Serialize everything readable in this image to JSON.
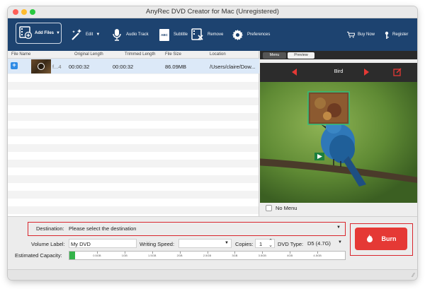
{
  "window": {
    "title": "AnyRec DVD Creator for Mac (Unregistered)"
  },
  "toolbar": {
    "add_files": "Add Files",
    "edit": "Edit",
    "audio_track": "Audio Track",
    "subtitle": "Subtitle",
    "subtitle_icon_text": "ABC",
    "remove": "Remove",
    "preferences": "Preferences",
    "buy_now": "Buy Now",
    "register": "Register"
  },
  "file_table": {
    "headers": {
      "file_name": "File Name",
      "original_length": "Original Length",
      "trimmed_length": "Trimmed Length",
      "file_size": "File Size",
      "location": "Location"
    },
    "rows": [
      {
        "name": "f...4",
        "original_length": "00:00:32",
        "trimmed_length": "00:00:32",
        "file_size": "86.09MB",
        "location": "/Users/claire/Dow..."
      }
    ]
  },
  "preview": {
    "tabs": {
      "menu": "Menu",
      "preview": "Preview"
    },
    "title": "Bird",
    "no_menu": "No Menu"
  },
  "settings": {
    "destination_label": "Destination:",
    "destination_value": "Please select the destination",
    "volume_label": "Volume Label:",
    "volume_value": "My DVD",
    "writing_speed_label": "Writing Speed:",
    "writing_speed_value": "",
    "copies_label": "Copies:",
    "copies_value": "1",
    "dvd_type_label": "DVD Type:",
    "dvd_type_value": "D5 (4.7G)",
    "capacity_label": "Estimated Capacity:",
    "capacity_ticks": [
      "0.5GB",
      "1GB",
      "1.5GB",
      "2GB",
      "2.5GB",
      "3GB",
      "3.5GB",
      "4GB",
      "4.5GB"
    ],
    "capacity_fill_fraction": 0.02,
    "burn_label": "Burn"
  },
  "colors": {
    "toolbar_bg": "#1d4370",
    "accent_red": "#e53935",
    "highlight_border": "#d9262d"
  }
}
